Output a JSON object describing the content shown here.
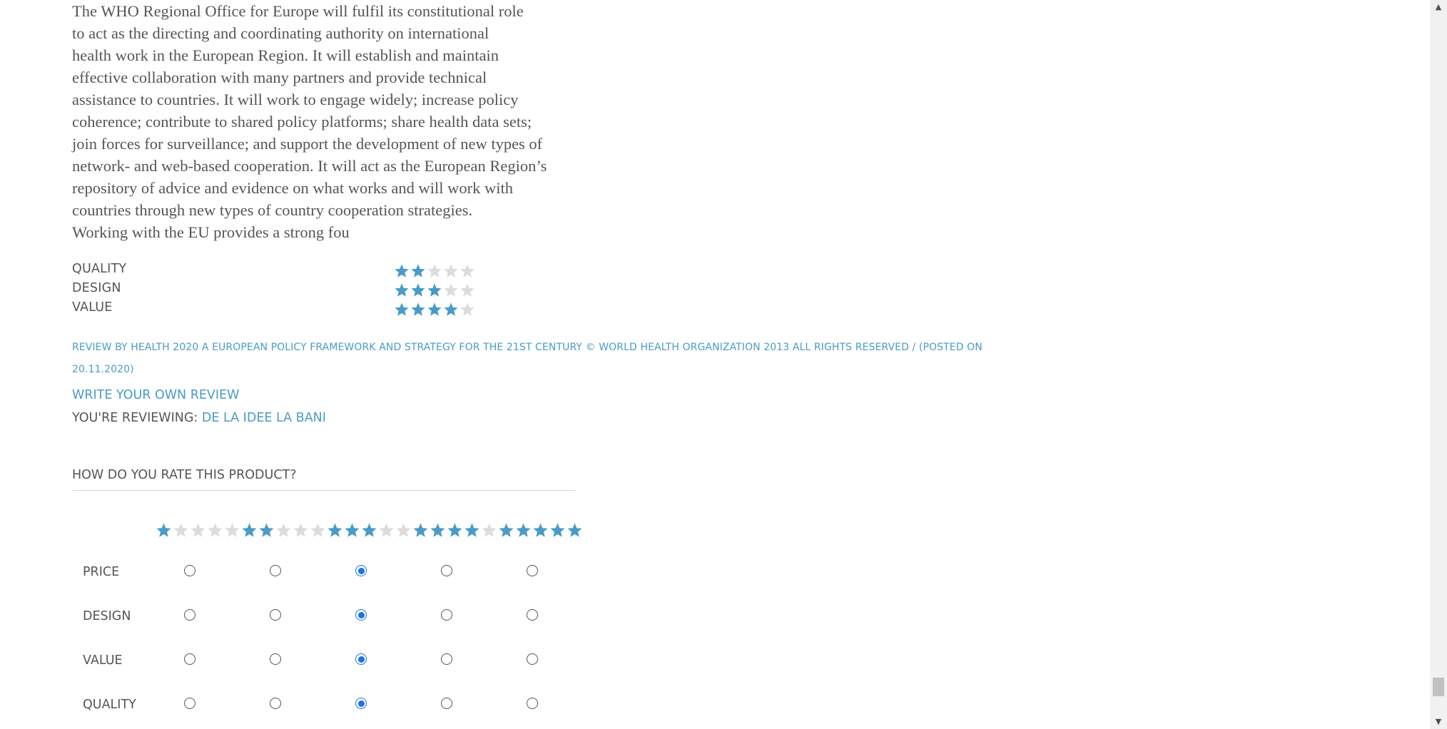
{
  "review": {
    "body_lines": [
      "The WHO Regional Office for Europe will fulfil its constitutional role",
      "to act as the directing and coordinating authority on international",
      "health work in the European Region. It will establish and maintain",
      "effective collaboration with many partners and provide technical",
      "assistance to countries. It will work to engage widely; increase policy",
      "coherence; contribute to shared policy platforms; share health data sets;",
      "join forces for surveillance; and support the development of new types of",
      "network- and web-based cooperation. It will act as the European Region’s",
      "repository of advice and evidence on what works and will work with",
      "countries through new types of country cooperation strategies.",
      "Working with the EU provides a strong fou"
    ],
    "ratings": [
      {
        "label": "QUALITY",
        "stars": 2
      },
      {
        "label": "DESIGN",
        "stars": 3
      },
      {
        "label": "VALUE",
        "stars": 4
      }
    ],
    "meta_lines": [
      "REVIEW BY HEALTH 2020 A EUROPEAN POLICY FRAMEWORK AND STRATEGY FOR THE 21ST CENTURY © WORLD HEALTH ORGANIZATION 2013 ALL RIGHTS RESERVED / (POSTED ON",
      "20.11.2020)"
    ]
  },
  "form": {
    "write_review_label": "WRITE YOUR OWN REVIEW",
    "reviewing_prefix": "YOU'RE REVIEWING:",
    "product_name": "DE LA IDEE LA BANI",
    "legend": "HOW DO YOU RATE THIS PRODUCT?",
    "column_stars": [
      1,
      2,
      3,
      4,
      5
    ],
    "rows": [
      {
        "label": "PRICE",
        "selected": 3
      },
      {
        "label": "DESIGN",
        "selected": 3
      },
      {
        "label": "VALUE",
        "selected": 3
      },
      {
        "label": "QUALITY",
        "selected": 3
      }
    ]
  },
  "colors": {
    "star_filled": "#4a9bc7",
    "star_empty": "#dcdcdc",
    "link": "#4a9bc7",
    "radio_checked": "#1a73e8"
  },
  "icons": {
    "scroll_up": "▲",
    "scroll_down": "▼",
    "star": "star-icon"
  }
}
